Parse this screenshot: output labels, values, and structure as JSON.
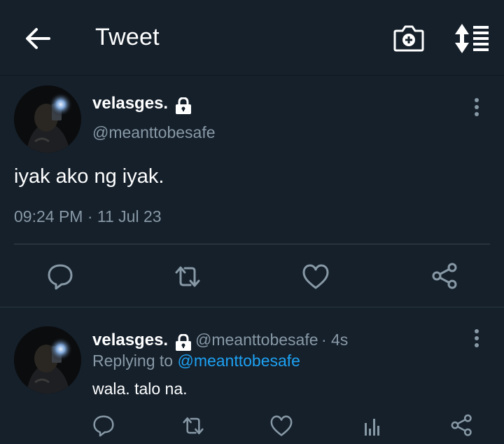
{
  "header": {
    "title": "Tweet",
    "back_icon": "arrow-left-icon",
    "camera_icon": "camera-add-icon",
    "sort_icon": "sort-list-icon"
  },
  "tweet": {
    "display_name": "velasges.",
    "handle": "@meanttobesafe",
    "text": "iyak ako ng iyak.",
    "time": "09:24 PM",
    "separator": " · ",
    "date": "11 Jul 23",
    "actions": [
      "reply-icon",
      "retweet-icon",
      "like-icon",
      "share-icon"
    ]
  },
  "reply": {
    "display_name": "velasges.",
    "handle": "@meanttobesafe",
    "age": "· 4s",
    "replying_prefix": "Replying to ",
    "replying_to": "@meanttobesafe",
    "text": "wala. talo na.",
    "actions": [
      "reply-icon",
      "retweet-icon",
      "like-icon",
      "analytics-icon",
      "share-icon"
    ]
  },
  "colors": {
    "background": "#15202b",
    "secondary_text": "#8899a6",
    "link": "#1da1f2",
    "divider": "#38444d"
  }
}
